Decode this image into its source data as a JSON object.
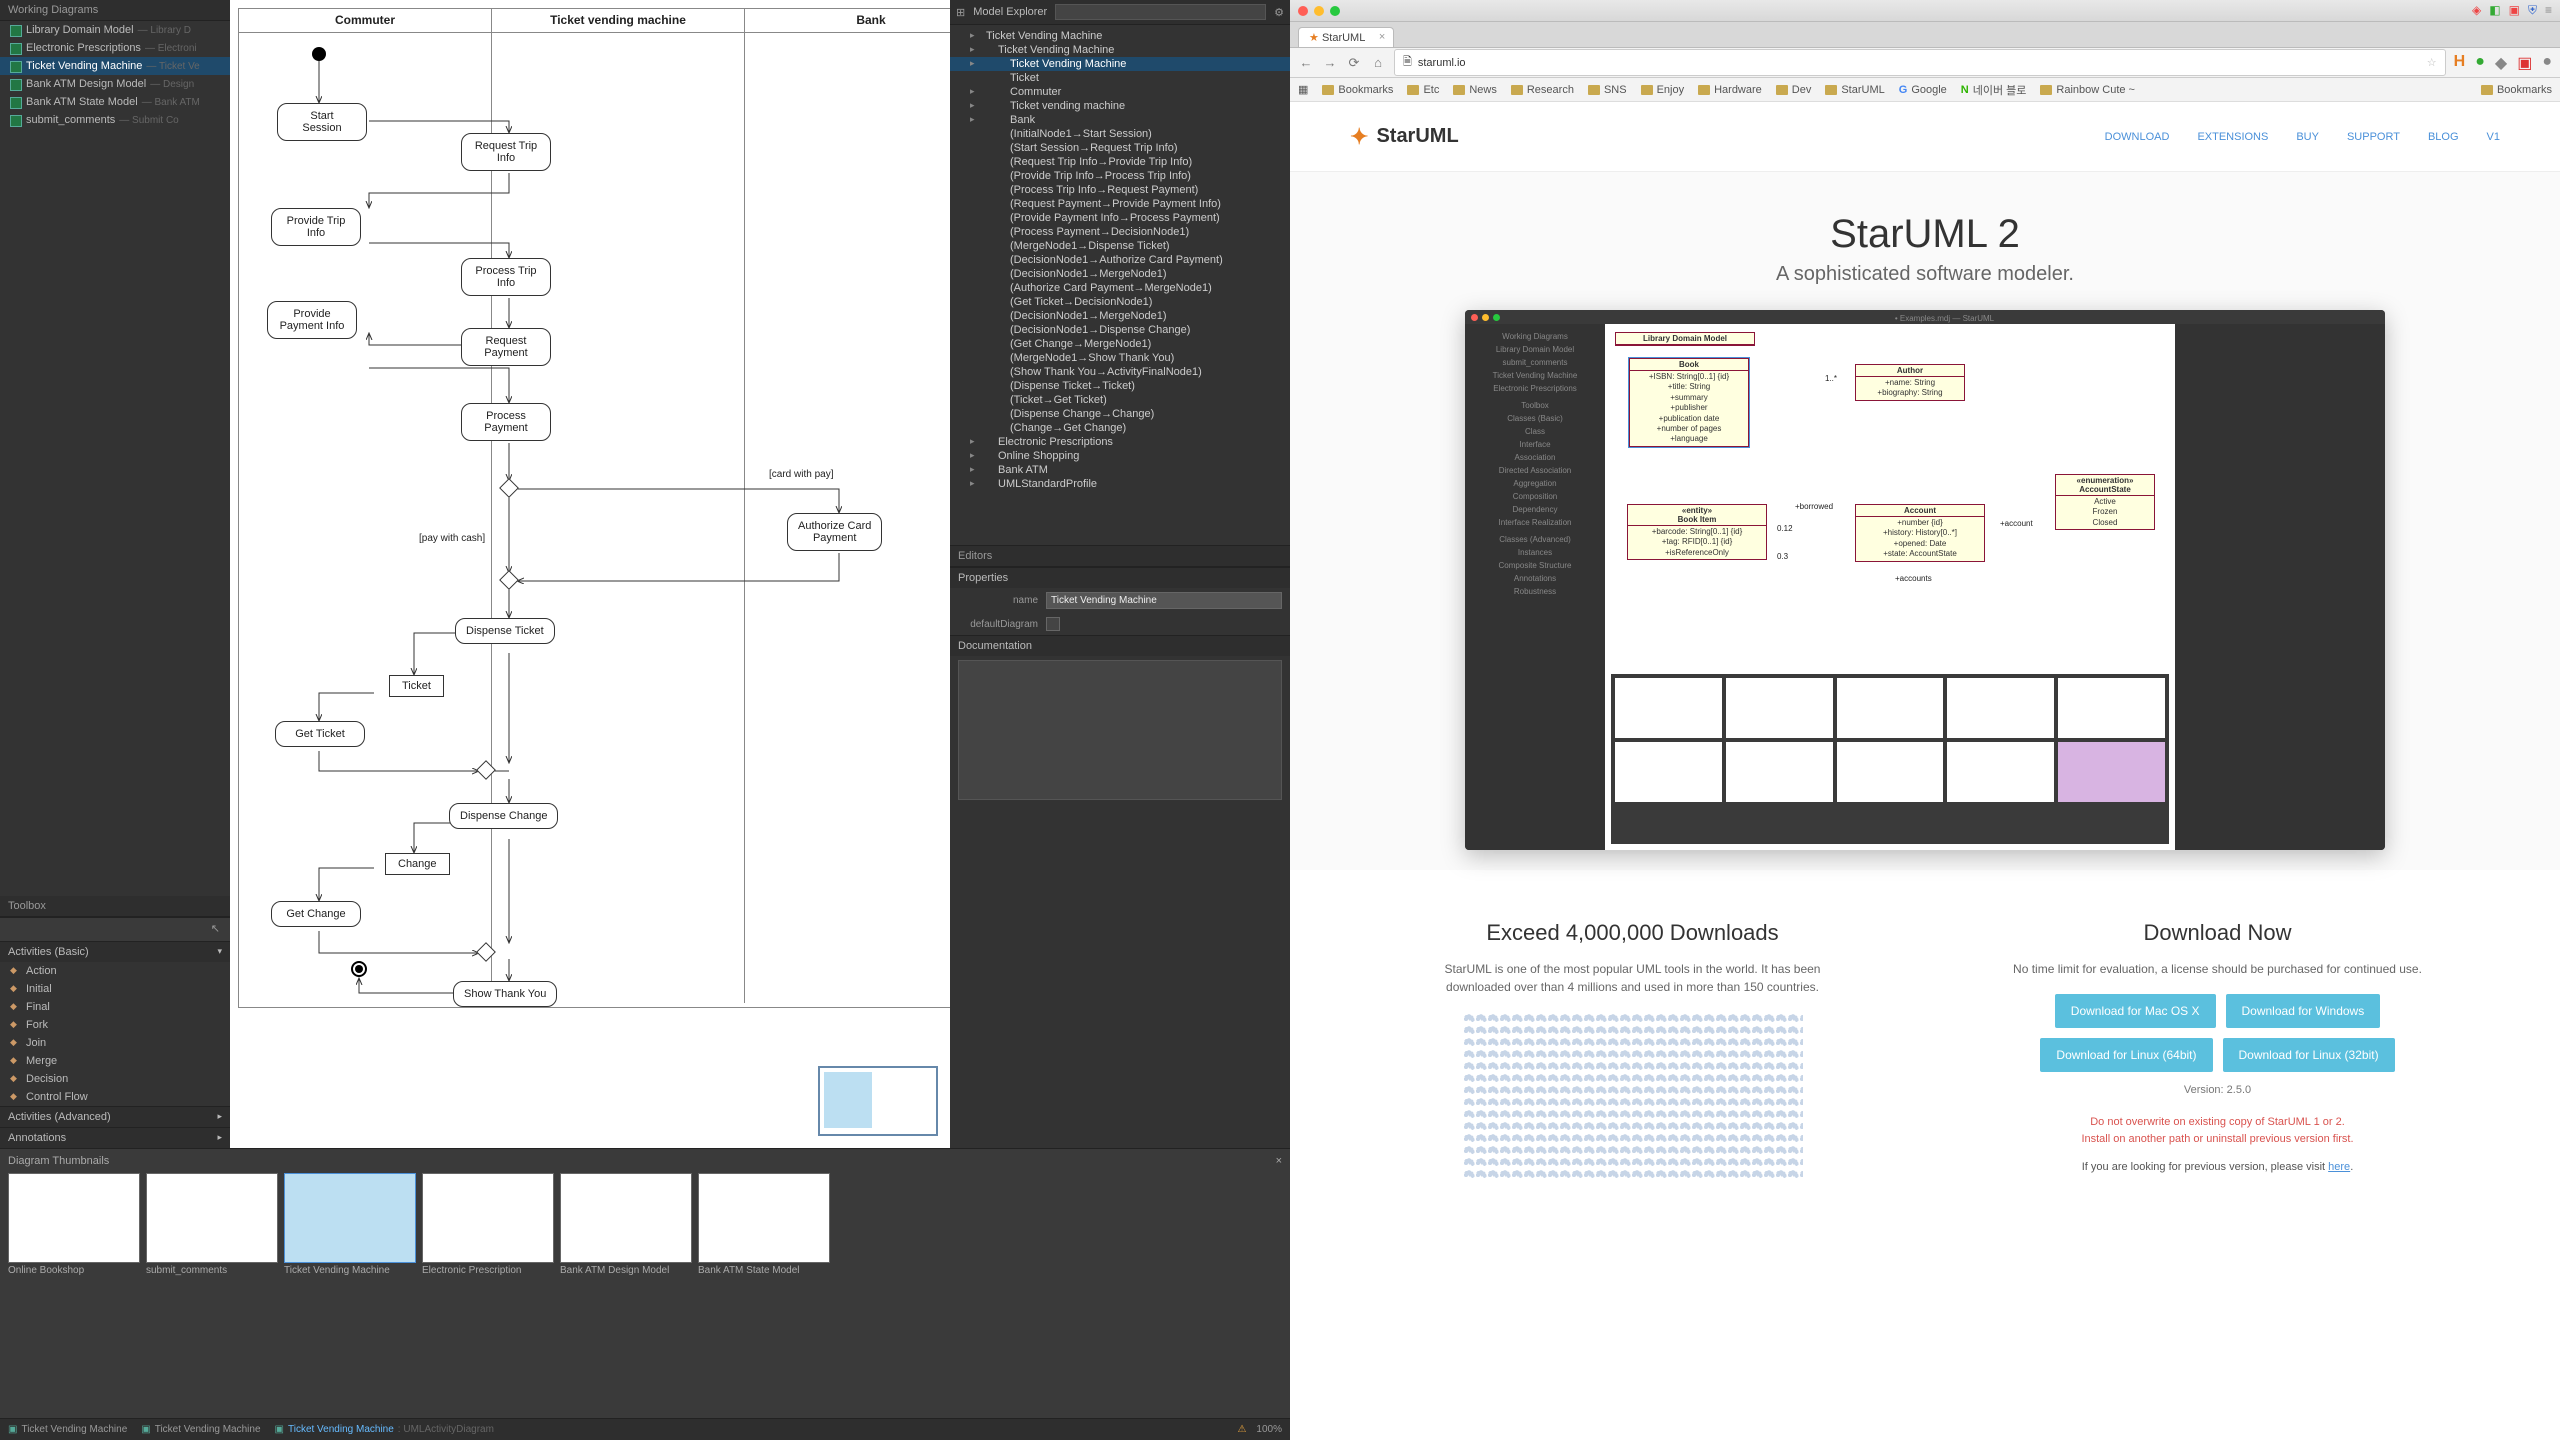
{
  "left_app": {
    "working_diagrams": {
      "title": "Working Diagrams",
      "items": [
        {
          "label": "Library Domain Model",
          "sub": "— Library D"
        },
        {
          "label": "Electronic Prescriptions",
          "sub": "— Electroni"
        },
        {
          "label": "Ticket Vending Machine",
          "sub": "— Ticket Ve",
          "selected": true
        },
        {
          "label": "Bank ATM Design Model",
          "sub": "— Design"
        },
        {
          "label": "Bank ATM State Model",
          "sub": "— Bank ATM"
        },
        {
          "label": "submit_comments",
          "sub": "— Submit Co"
        }
      ]
    },
    "toolbox": {
      "title": "Toolbox",
      "sections": [
        {
          "label": "Activities (Basic)",
          "open": true,
          "items": [
            {
              "label": "Action"
            },
            {
              "label": "Initial"
            },
            {
              "label": "Final"
            },
            {
              "label": "Fork"
            },
            {
              "label": "Join"
            },
            {
              "label": "Merge"
            },
            {
              "label": "Decision"
            },
            {
              "label": "Control Flow"
            }
          ]
        },
        {
          "label": "Activities (Advanced)",
          "open": false
        },
        {
          "label": "Annotations",
          "open": false
        }
      ]
    },
    "diagram": {
      "swimlanes": [
        "Commuter",
        "Ticket vending machine",
        "Bank"
      ],
      "nodes": {
        "start_session": "Start\nSession",
        "request_trip_info": "Request Trip\nInfo",
        "provide_trip_info": "Provide Trip\nInfo",
        "process_trip_info": "Process Trip\nInfo",
        "provide_payment_info": "Provide\nPayment Info",
        "request_payment": "Request\nPayment",
        "process_payment": "Process\nPayment",
        "authorize_card": "Authorize Card\nPayment",
        "dispense_ticket": "Dispense Ticket",
        "ticket": "Ticket",
        "get_ticket": "Get Ticket",
        "dispense_change": "Dispense Change",
        "change": "Change",
        "get_change": "Get Change",
        "show_thank_you": "Show Thank You"
      },
      "edge_labels": {
        "card_with_pay": "[card with pay]",
        "pay_with_cash": "[pay with cash]"
      }
    },
    "model_explorer": {
      "title": "Model Explorer",
      "search_placeholder": "",
      "tree": [
        {
          "label": "Ticket Vending Machine",
          "depth": 0
        },
        {
          "label": "Ticket Vending Machine",
          "depth": 1
        },
        {
          "label": "Ticket Vending Machine",
          "depth": 2,
          "selected": true
        },
        {
          "label": "Ticket",
          "depth": 2,
          "leaf": true
        },
        {
          "label": "Commuter",
          "depth": 2
        },
        {
          "label": "Ticket vending machine",
          "depth": 2
        },
        {
          "label": "Bank",
          "depth": 2
        },
        {
          "label": "(InitialNode1→Start Session)",
          "depth": 2,
          "leaf": true
        },
        {
          "label": "(Start Session→Request Trip Info)",
          "depth": 2,
          "leaf": true
        },
        {
          "label": "(Request Trip Info→Provide Trip Info)",
          "depth": 2,
          "leaf": true
        },
        {
          "label": "(Provide Trip Info→Process Trip Info)",
          "depth": 2,
          "leaf": true
        },
        {
          "label": "(Process Trip Info→Request Payment)",
          "depth": 2,
          "leaf": true
        },
        {
          "label": "(Request Payment→Provide Payment Info)",
          "depth": 2,
          "leaf": true
        },
        {
          "label": "(Provide Payment Info→Process Payment)",
          "depth": 2,
          "leaf": true
        },
        {
          "label": "(Process Payment→DecisionNode1)",
          "depth": 2,
          "leaf": true
        },
        {
          "label": "(MergeNode1→Dispense Ticket)",
          "depth": 2,
          "leaf": true
        },
        {
          "label": "(DecisionNode1→Authorize Card Payment)",
          "depth": 2,
          "leaf": true
        },
        {
          "label": "(DecisionNode1→MergeNode1)",
          "depth": 2,
          "leaf": true
        },
        {
          "label": "(Authorize Card Payment→MergeNode1)",
          "depth": 2,
          "leaf": true
        },
        {
          "label": "(Get Ticket→DecisionNode1)",
          "depth": 2,
          "leaf": true
        },
        {
          "label": "(DecisionNode1→MergeNode1)",
          "depth": 2,
          "leaf": true
        },
        {
          "label": "(DecisionNode1→Dispense Change)",
          "depth": 2,
          "leaf": true
        },
        {
          "label": "(Get Change→MergeNode1)",
          "depth": 2,
          "leaf": true
        },
        {
          "label": "(MergeNode1→Show Thank You)",
          "depth": 2,
          "leaf": true
        },
        {
          "label": "(Show Thank You→ActivityFinalNode1)",
          "depth": 2,
          "leaf": true
        },
        {
          "label": "(Dispense Ticket→Ticket)",
          "depth": 2,
          "leaf": true
        },
        {
          "label": "(Ticket→Get Ticket)",
          "depth": 2,
          "leaf": true
        },
        {
          "label": "(Dispense Change→Change)",
          "depth": 2,
          "leaf": true
        },
        {
          "label": "(Change→Get Change)",
          "depth": 2,
          "leaf": true
        },
        {
          "label": "Electronic Prescriptions",
          "depth": 1
        },
        {
          "label": "Online Shopping",
          "depth": 1
        },
        {
          "label": "Bank ATM",
          "depth": 1
        },
        {
          "label": "UMLStandardProfile",
          "depth": 1
        }
      ]
    },
    "editors": {
      "title": "Editors",
      "properties_label": "Properties",
      "name_label": "name",
      "name_value": "Ticket Vending Machine",
      "default_diagram_label": "defaultDiagram",
      "documentation_label": "Documentation"
    },
    "thumbnails": {
      "title": "Diagram Thumbnails",
      "items": [
        {
          "label": "Online Bookshop"
        },
        {
          "label": "submit_comments"
        },
        {
          "label": "Ticket Vending Machine",
          "selected": true
        },
        {
          "label": "Electronic Prescription"
        },
        {
          "label": "Bank ATM Design Model"
        },
        {
          "label": "Bank ATM State Model"
        }
      ]
    },
    "statusbar": {
      "tabs": [
        {
          "label": "Ticket Vending Machine"
        },
        {
          "label": "Ticket Vending Machine"
        },
        {
          "label": "Ticket Vending Machine",
          "active": true,
          "sub": "UMLActivityDiagram"
        }
      ],
      "zoom": "100%",
      "warn_icon": "⚠"
    }
  },
  "right_app": {
    "tab_title": "StarUML",
    "url": "staruml.io",
    "title_icons": [
      "html5-icon",
      "ext-icon",
      "ext-icon",
      "shield-icon",
      "menu-icon"
    ],
    "bookmarks": [
      {
        "label": "Bookmarks"
      },
      {
        "label": "Etc"
      },
      {
        "label": "News"
      },
      {
        "label": "Research"
      },
      {
        "label": "SNS"
      },
      {
        "label": "Enjoy"
      },
      {
        "label": "Hardware"
      },
      {
        "label": "Dev"
      },
      {
        "label": "StarUML"
      },
      {
        "label": "Google",
        "g": true
      },
      {
        "label": "네이버 블로",
        "n": true
      },
      {
        "label": "Rainbow Cute ~"
      }
    ],
    "bookmarks_right": "Bookmarks",
    "site": {
      "logo_text": "StarUML",
      "nav": [
        "DOWNLOAD",
        "EXTENSIONS",
        "BUY",
        "SUPPORT",
        "BLOG",
        "V1"
      ],
      "hero_title": "StarUML 2",
      "hero_sub": "A sophisticated software modeler.",
      "hero_diagram": {
        "title_strip": "• Examples.mdj — StarUML",
        "left_items": [
          "Working Diagrams",
          "Library Domain Model",
          "submit_comments",
          "Ticket Vending Machine",
          "Electronic Prescriptions",
          "",
          "Toolbox",
          "Classes (Basic)",
          "Class",
          "Interface",
          "Association",
          "Directed Association",
          "Aggregation",
          "Composition",
          "Dependency",
          "Interface Realization",
          "",
          "Classes (Advanced)",
          "Instances",
          "Composite Structure",
          "Annotations",
          "Robustness"
        ],
        "classes": {
          "library": {
            "name": "Library Domain Model"
          },
          "book": {
            "name": "Book",
            "attrs": "+ISBN: String[0..1] {id}\n+title: String\n+summary\n+publisher\n+publication date\n+number of pages\n+language"
          },
          "author": {
            "name": "Author",
            "attrs": "+name: String\n+biography: String"
          },
          "bookitem": {
            "name": "Book Item",
            "stereo": "«entity»",
            "attrs": "+barcode: String[0..1] {id}\n+tag: RFID[0..1] {id}\n+isReferenceOnly"
          },
          "account": {
            "name": "Account",
            "attrs": "+number {id}\n+history: History[0..*]\n+opened: Date\n+state: AccountState"
          },
          "enum": {
            "name": "«enumeration»\nAccountState",
            "attrs": "Active\nFrozen\nClosed"
          }
        },
        "assocs": {
          "borrowed": "+borrowed",
          "account": "+account",
          "accounts": "+accounts",
          "m1": "1..*",
          "m2": "0.12",
          "m3": "0.3"
        }
      },
      "col_left": {
        "title": "Exceed 4,000,000 Downloads",
        "text": "StarUML is one of the most popular UML tools in the world. It has been downloaded over than 4 millions and used in more than 150 countries."
      },
      "col_right": {
        "title": "Download Now",
        "text": "No time limit for evaluation, a license should be purchased for continued use.",
        "buttons": [
          "Download for Mac OS X",
          "Download for Windows",
          "Download for Linux (64bit)",
          "Download for Linux (32bit)"
        ],
        "version": "Version: 2.5.0",
        "warn1": "Do not overwrite on existing copy of StarUML 1 or 2.\nInstall on another path or uninstall previous version first.",
        "warn2_pre": "If you are looking for previous version, please visit ",
        "warn2_link": "here",
        "warn2_post": "."
      }
    }
  }
}
